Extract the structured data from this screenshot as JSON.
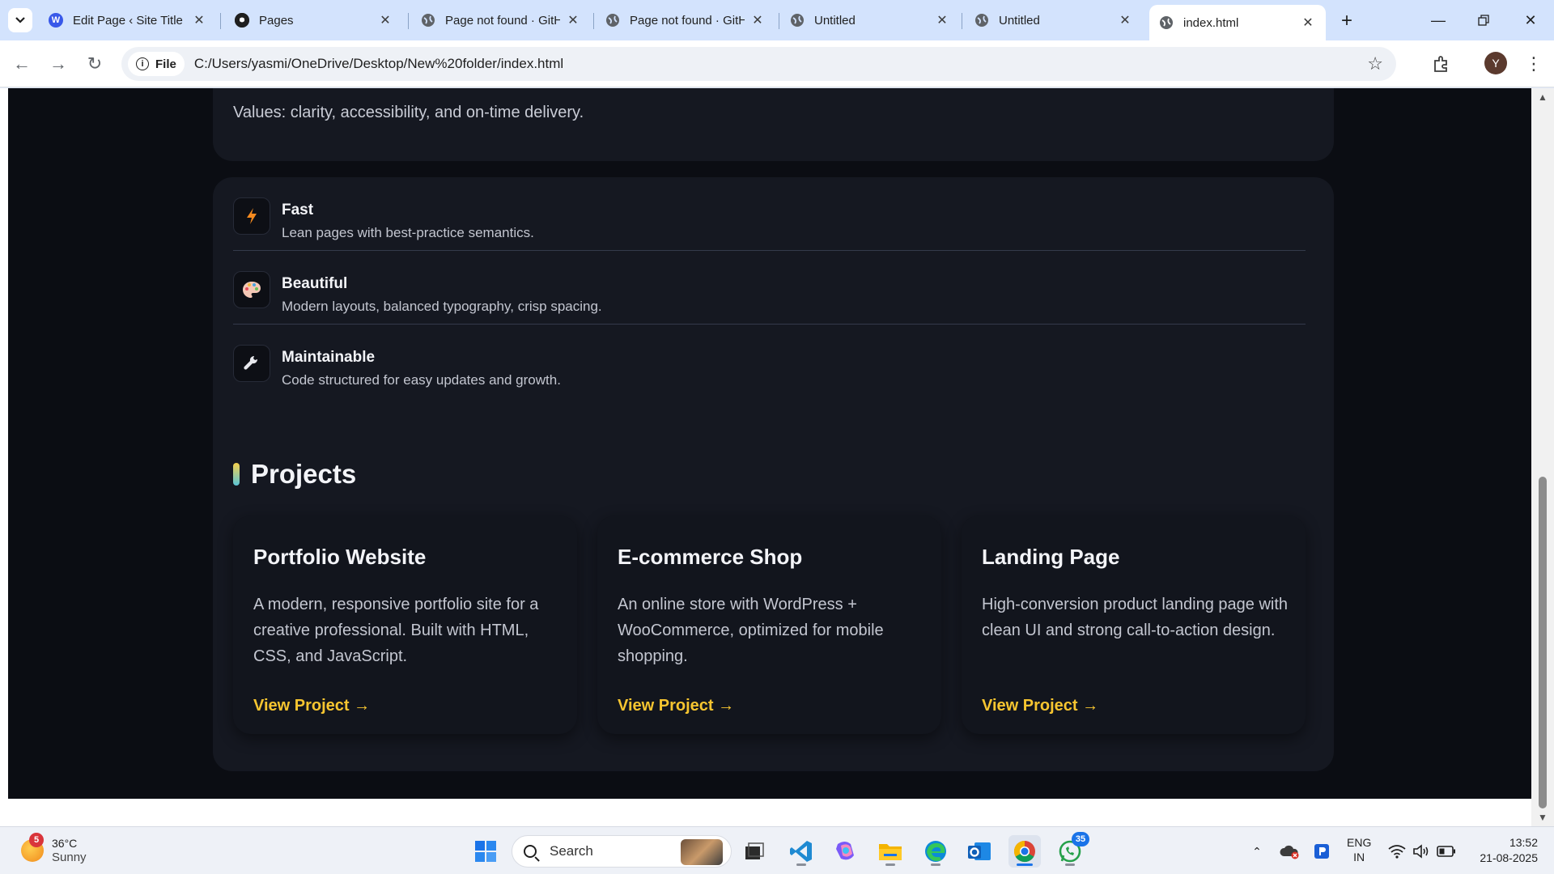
{
  "browser": {
    "tabs": [
      {
        "title": "Edit Page ‹ Site Title —",
        "icon": "wordpress-icon"
      },
      {
        "title": "Pages",
        "icon": "github-icon"
      },
      {
        "title": "Page not found · GitHub",
        "icon": "globe-icon"
      },
      {
        "title": "Page not found · GitHub",
        "icon": "globe-icon"
      },
      {
        "title": "Untitled",
        "icon": "globe-icon"
      },
      {
        "title": "Untitled",
        "icon": "globe-icon"
      },
      {
        "title": "index.html",
        "icon": "globe-icon",
        "active": true
      }
    ],
    "address": {
      "scheme_label": "File",
      "url": "C:/Users/yasmi/OneDrive/Desktop/New%20folder/index.html"
    },
    "profile_initial": "Y"
  },
  "page": {
    "values_text": "Values: clarity, accessibility, and on-time delivery.",
    "features": [
      {
        "name": "Fast",
        "desc": "Lean pages with best-practice semantics.",
        "icon": "lightning-icon"
      },
      {
        "name": "Beautiful",
        "desc": "Modern layouts, balanced typography, crisp spacing.",
        "icon": "palette-icon"
      },
      {
        "name": "Maintainable",
        "desc": "Code structured for easy updates and growth.",
        "icon": "wrench-icon"
      }
    ],
    "projects_heading": "Projects",
    "projects": [
      {
        "title": "Portfolio Website",
        "desc": "A modern, responsive portfolio site for a creative professional. Built with HTML, CSS, and JavaScript.",
        "link": "View Project →"
      },
      {
        "title": "E-commerce Shop",
        "desc": "An online store with WordPress + WooCommerce, optimized for mobile shopping.",
        "link": "View Project →"
      },
      {
        "title": "Landing Page",
        "desc": "High-conversion product landing page with clean UI and strong call-to-action design.",
        "link": "View Project →"
      }
    ]
  },
  "taskbar": {
    "weather": {
      "badge": "5",
      "temp": "36°C",
      "condition": "Sunny"
    },
    "search_label": "Search",
    "whatsapp_badge": "35",
    "lang": {
      "line1": "ENG",
      "line2": "IN"
    },
    "clock": {
      "time": "13:52",
      "date": "21-08-2025"
    }
  },
  "colors": {
    "page_bg": "#0b0d13",
    "card_bg": "#151821",
    "accent_link": "#f6c530",
    "tabstrip": "#d3e3fd"
  }
}
